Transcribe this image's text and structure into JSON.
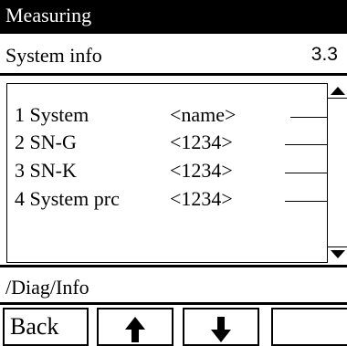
{
  "window": {
    "title": "Measuring"
  },
  "header": {
    "label": "System info",
    "number": "3.3"
  },
  "list": {
    "items": [
      {
        "label": "1 System",
        "value": "<name>"
      },
      {
        "label": "2  SN-G",
        "value": "<1234>"
      },
      {
        "label": "3  SN-K",
        "value": "<1234>"
      },
      {
        "label": "4  System prc",
        "value": "<1234>"
      }
    ]
  },
  "path": {
    "text": "/Diag/Info"
  },
  "softkeys": {
    "back_label": "Back",
    "up_icon": "arrow-up-icon",
    "down_icon": "arrow-down-icon"
  }
}
